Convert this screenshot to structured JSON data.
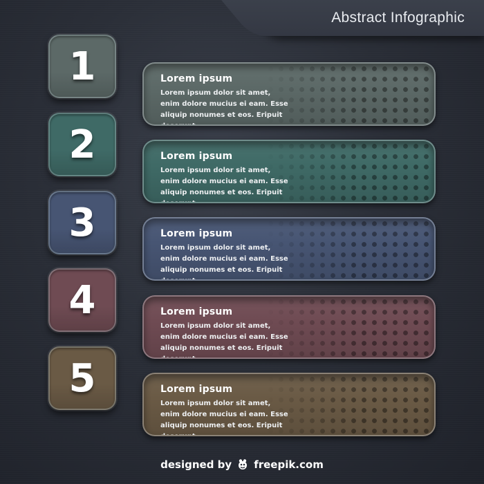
{
  "title": "Abstract Infographic",
  "items": [
    {
      "number": "1",
      "heading": "Lorem ipsum",
      "body": "Lorem ipsum dolor sit amet, enim dolore mucius ei eam. Esse aliquip nonumes et eos. Eripuit deserunt.",
      "color": "#5c6967"
    },
    {
      "number": "2",
      "heading": "Lorem ipsum",
      "body": "Lorem ipsum dolor sit amet, enim dolore mucius ei eam. Esse aliquip nonumes et eos. Eripuit deserunt.",
      "color": "#3f6a66"
    },
    {
      "number": "3",
      "heading": "Lorem ipsum",
      "body": "Lorem ipsum dolor sit amet, enim dolore mucius ei eam. Esse aliquip nonumes et eos. Eripuit deserunt.",
      "color": "#475573"
    },
    {
      "number": "4",
      "heading": "Lorem ipsum",
      "body": "Lorem ipsum dolor sit amet, enim dolore mucius ei eam. Esse aliquip nonumes et eos. Eripuit deserunt.",
      "color": "#6f4b53"
    },
    {
      "number": "5",
      "heading": "Lorem ipsum",
      "body": "Lorem ipsum dolor sit amet, enim dolore mucius ei eam. Esse aliquip nonumes et eos. Eripuit deserunt.",
      "color": "#6a5a45"
    }
  ],
  "footer": {
    "prefix": "designed by",
    "brand": "freepik.com",
    "logo_icon": "freepik-logo-icon"
  }
}
